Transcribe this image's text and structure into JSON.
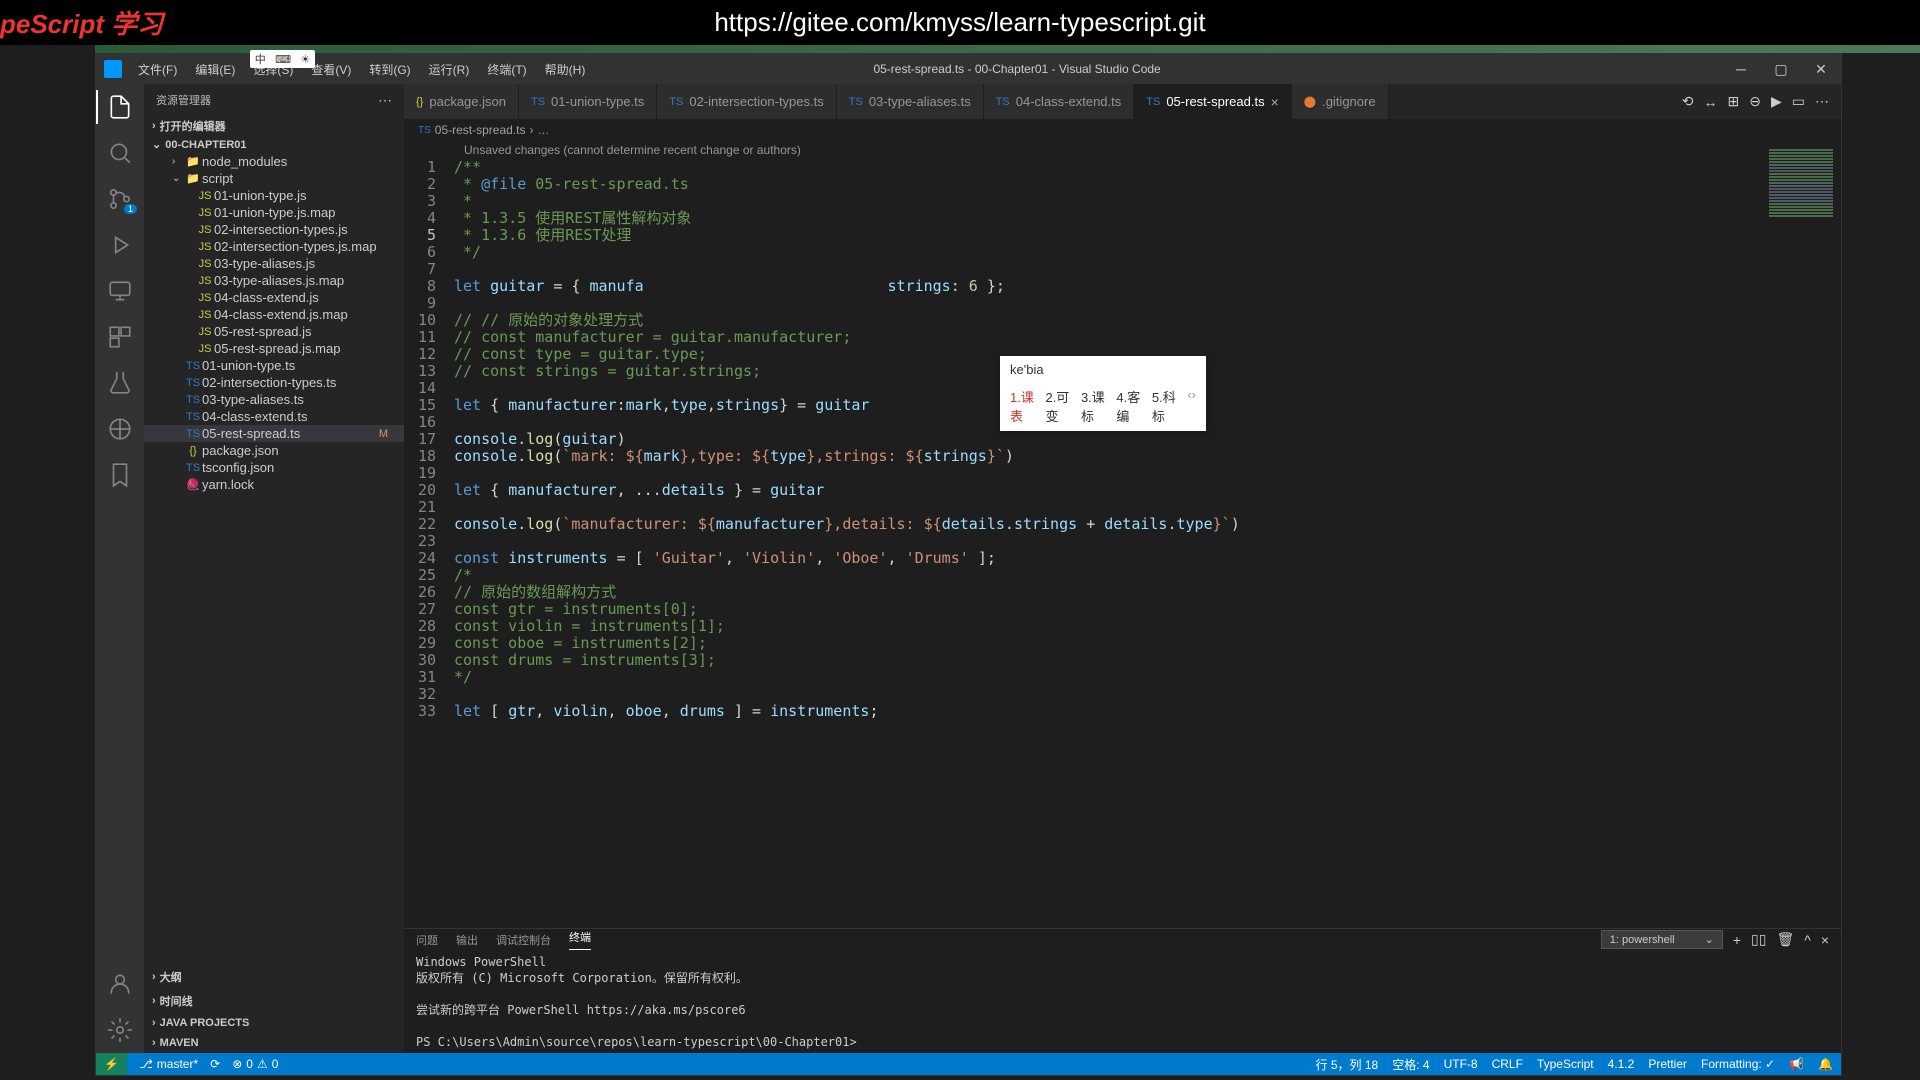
{
  "topbar": {
    "left_text": "peScript 学习",
    "url": "https://gitee.com/kmyss/learn-typescript.git"
  },
  "ime_bar": {
    "lang": "中",
    "caret": "⌨",
    "sun": "☀"
  },
  "titlebar": {
    "menu": [
      "文件(F)",
      "编辑(E)",
      "选择(S)",
      "查看(V)",
      "转到(G)",
      "运行(R)",
      "终端(T)",
      "帮助(H)"
    ],
    "title": "05-rest-spread.ts - 00-Chapter01 - Visual Studio Code"
  },
  "activity": {
    "scm_badge": "1"
  },
  "sidebar": {
    "header": "资源管理器",
    "open_editors": "打开的编辑器",
    "project": "00-CHAPTER01",
    "nodes": [
      {
        "label": "node_modules",
        "type": "folder",
        "pad": 2,
        "chev": "›"
      },
      {
        "label": "script",
        "type": "folder",
        "pad": 2,
        "chev": "⌄"
      },
      {
        "label": "01-union-type.js",
        "type": "js",
        "pad": 3
      },
      {
        "label": "01-union-type.js.map",
        "type": "js",
        "pad": 3
      },
      {
        "label": "02-intersection-types.js",
        "type": "js",
        "pad": 3
      },
      {
        "label": "02-intersection-types.js.map",
        "type": "js",
        "pad": 3
      },
      {
        "label": "03-type-aliases.js",
        "type": "js",
        "pad": 3
      },
      {
        "label": "03-type-aliases.js.map",
        "type": "js",
        "pad": 3
      },
      {
        "label": "04-class-extend.js",
        "type": "js",
        "pad": 3
      },
      {
        "label": "04-class-extend.js.map",
        "type": "js",
        "pad": 3
      },
      {
        "label": "05-rest-spread.js",
        "type": "js",
        "pad": 3
      },
      {
        "label": "05-rest-spread.js.map",
        "type": "js",
        "pad": 3
      },
      {
        "label": "01-union-type.ts",
        "type": "ts",
        "pad": 2
      },
      {
        "label": "02-intersection-types.ts",
        "type": "ts",
        "pad": 2
      },
      {
        "label": "03-type-aliases.ts",
        "type": "ts",
        "pad": 2
      },
      {
        "label": "04-class-extend.ts",
        "type": "ts",
        "pad": 2
      },
      {
        "label": "05-rest-spread.ts",
        "type": "ts",
        "pad": 2,
        "selected": true,
        "indicator": "M"
      },
      {
        "label": "package.json",
        "type": "json",
        "pad": 2
      },
      {
        "label": "tsconfig.json",
        "type": "ts",
        "pad": 2
      },
      {
        "label": "yarn.lock",
        "type": "yarn",
        "pad": 2
      }
    ],
    "bottom": [
      "大纲",
      "时间线",
      "JAVA PROJECTS",
      "MAVEN"
    ]
  },
  "tabs": [
    {
      "icon": "{}",
      "label": "package.json",
      "iconColor": "#cbcb41"
    },
    {
      "icon": "TS",
      "label": "01-union-type.ts",
      "iconColor": "#3178c6"
    },
    {
      "icon": "TS",
      "label": "02-intersection-types.ts",
      "iconColor": "#3178c6"
    },
    {
      "icon": "TS",
      "label": "03-type-aliases.ts",
      "iconColor": "#3178c6"
    },
    {
      "icon": "TS",
      "label": "04-class-extend.ts",
      "iconColor": "#3178c6"
    },
    {
      "icon": "TS",
      "label": "05-rest-spread.ts",
      "iconColor": "#3178c6",
      "active": true,
      "close": true
    },
    {
      "icon": "⬤",
      "label": ".gitignore",
      "iconColor": "#e37933"
    }
  ],
  "breadcrumb": {
    "icon": "TS",
    "file": "05-rest-spread.ts",
    "sep": "›",
    "more": "…"
  },
  "editor": {
    "banner": "Unsaved changes (cannot determine recent change or authors)",
    "lines": [
      {
        "n": 1,
        "html": "<span class='cmt'>/**</span>"
      },
      {
        "n": 2,
        "html": "<span class='cmt'> * </span><span class='kw'>@file</span><span class='cmt'> 05-rest-spread.ts</span>"
      },
      {
        "n": 3,
        "html": "<span class='cmt'> *</span>"
      },
      {
        "n": 4,
        "html": "<span class='cmt'> * 1.3.5 使用REST属性解构对象</span>"
      },
      {
        "n": 5,
        "html": "<span class='cmt'> * 1.3.6 使用REST处理</span>",
        "active": true
      },
      {
        "n": 6,
        "html": "<span class='cmt'> */</span>"
      },
      {
        "n": 7,
        "html": ""
      },
      {
        "n": 8,
        "html": "<span class='kw'>let</span> <span class='var'>guitar</span> <span class='punc'>= {</span> <span class='var'>manufa</span>                           <span class='var'>strings</span><span class='punc'>:</span> <span class='num'>6</span> <span class='punc'>};</span>"
      },
      {
        "n": 9,
        "html": ""
      },
      {
        "n": 10,
        "html": "<span class='cmt'>// // 原始的对象处理方式</span>"
      },
      {
        "n": 11,
        "html": "<span class='cmt'>// const manufacturer = guitar.manufacturer;</span>"
      },
      {
        "n": 12,
        "html": "<span class='cmt'>// const type = guitar.type;</span>"
      },
      {
        "n": 13,
        "html": "<span class='cmt'>// const strings = guitar.strings;</span>"
      },
      {
        "n": 14,
        "html": ""
      },
      {
        "n": 15,
        "html": "<span class='kw'>let</span> <span class='punc'>{</span> <span class='var'>manufacturer</span><span class='punc'>:</span><span class='var'>mark</span><span class='punc'>,</span><span class='var'>type</span><span class='punc'>,</span><span class='var'>strings</span><span class='punc'>} =</span> <span class='var'>guitar</span>"
      },
      {
        "n": 16,
        "html": ""
      },
      {
        "n": 17,
        "html": "<span class='var'>console</span><span class='punc'>.</span><span class='fn'>log</span><span class='punc'>(</span><span class='var'>guitar</span><span class='punc'>)</span>"
      },
      {
        "n": 18,
        "html": "<span class='var'>console</span><span class='punc'>.</span><span class='fn'>log</span><span class='punc'>(</span><span class='tmpl'>`mark: ${</span><span class='var'>mark</span><span class='tmpl'>},type: ${</span><span class='var'>type</span><span class='tmpl'>},strings: ${</span><span class='var'>strings</span><span class='tmpl'>}`</span><span class='punc'>)</span>"
      },
      {
        "n": 19,
        "html": ""
      },
      {
        "n": 20,
        "html": "<span class='kw'>let</span> <span class='punc'>{</span> <span class='var'>manufacturer</span><span class='punc'>, ...</span><span class='var'>details</span> <span class='punc'>} =</span> <span class='var'>guitar</span>"
      },
      {
        "n": 21,
        "html": ""
      },
      {
        "n": 22,
        "html": "<span class='var'>console</span><span class='punc'>.</span><span class='fn'>log</span><span class='punc'>(</span><span class='tmpl'>`manufacturer: ${</span><span class='var'>manufacturer</span><span class='tmpl'>},details: ${</span><span class='var'>details</span><span class='punc'>.</span><span class='var'>strings</span> <span class='punc'>+</span> <span class='var'>details</span><span class='punc'>.</span><span class='var'>type</span><span class='tmpl'>}`</span><span class='punc'>)</span>"
      },
      {
        "n": 23,
        "html": ""
      },
      {
        "n": 24,
        "html": "<span class='kw'>const</span> <span class='var'>instruments</span> <span class='punc'>= [</span> <span class='str'>'Guitar'</span><span class='punc'>,</span> <span class='str'>'Violin'</span><span class='punc'>,</span> <span class='str'>'Oboe'</span><span class='punc'>,</span> <span class='str'>'Drums'</span> <span class='punc'>];</span>"
      },
      {
        "n": 25,
        "html": "<span class='cmt'>/*</span>"
      },
      {
        "n": 26,
        "html": "<span class='cmt'>// 原始的数组解构方式</span>"
      },
      {
        "n": 27,
        "html": "<span class='cmt'>const gtr = instruments[0];</span>"
      },
      {
        "n": 28,
        "html": "<span class='cmt'>const violin = instruments[1];</span>"
      },
      {
        "n": 29,
        "html": "<span class='cmt'>const oboe = instruments[2];</span>"
      },
      {
        "n": 30,
        "html": "<span class='cmt'>const drums = instruments[3];</span>"
      },
      {
        "n": 31,
        "html": "<span class='cmt'>*/</span>"
      },
      {
        "n": 32,
        "html": ""
      },
      {
        "n": 33,
        "html": "<span class='kw'>let</span> <span class='punc'>[</span> <span class='var'>gtr</span><span class='punc'>,</span> <span class='var'>violin</span><span class='punc'>,</span> <span class='var'>oboe</span><span class='punc'>,</span> <span class='var'>drums</span> <span class='punc'>] =</span> <span class='var'>instruments</span><span class='punc'>;</span>"
      }
    ]
  },
  "ime_popup": {
    "input": "ke'bia",
    "candidates": [
      "1.课表",
      "2.可变",
      "3.课标",
      "4.客编",
      "5.科标"
    ]
  },
  "terminal": {
    "panel_tabs": [
      "问题",
      "输出",
      "调试控制台",
      "终端"
    ],
    "active_tab": 3,
    "dropdown": "1: powershell",
    "lines": [
      "Windows PowerShell",
      "版权所有 (C) Microsoft Corporation。保留所有权利。",
      "",
      "尝试新的跨平台 PowerShell https://aka.ms/pscore6",
      "",
      "PS C:\\Users\\Admin\\source\\repos\\learn-typescript\\00-Chapter01>"
    ]
  },
  "statusbar": {
    "branch": "master*",
    "sync": "⟳",
    "errors": "0",
    "warnings": "0",
    "cursor": "行 5，列 18",
    "spaces": "空格: 4",
    "encoding": "UTF-8",
    "eol": "CRLF",
    "lang": "TypeScript",
    "tsver": "4.1.2",
    "prettier": "Prettier",
    "formatting": "Formatting: ✓"
  }
}
